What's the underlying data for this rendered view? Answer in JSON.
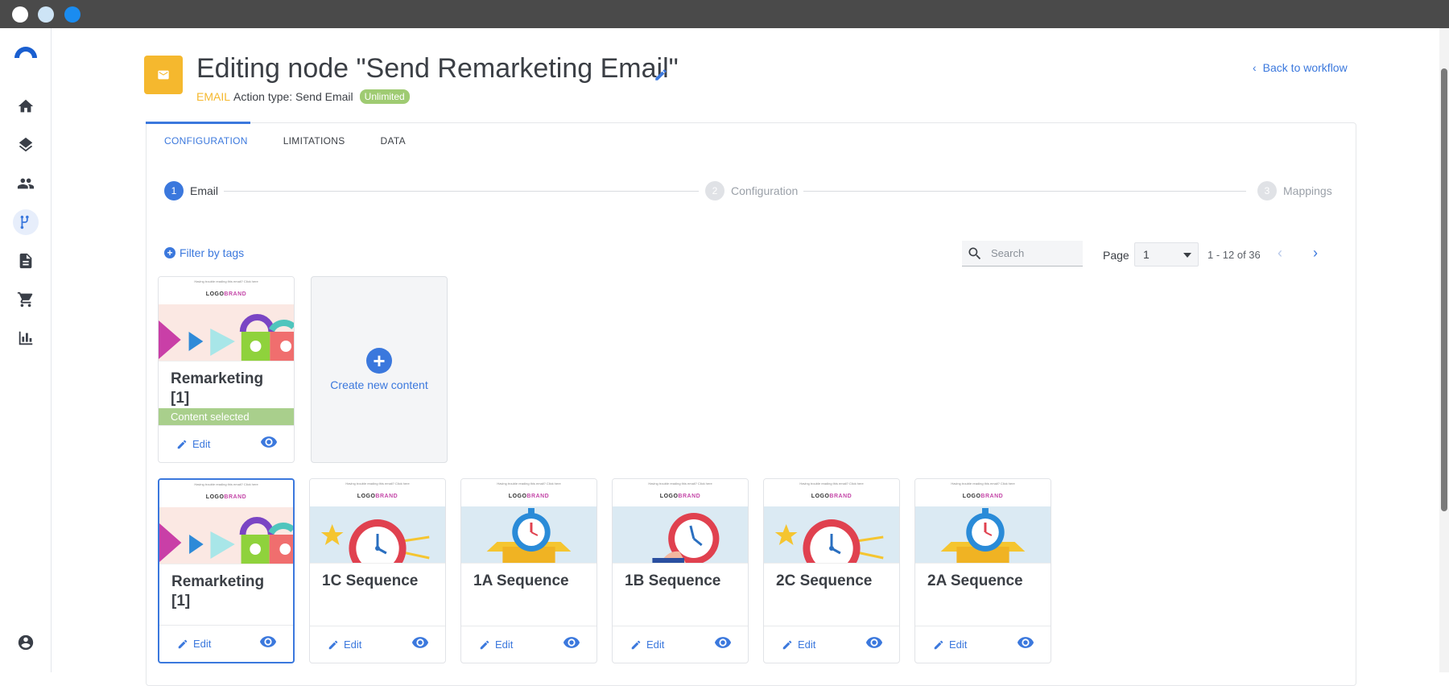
{
  "window": {
    "controls": [
      "close",
      "minimize",
      "maximize"
    ]
  },
  "sidebar": {
    "items": [
      {
        "name": "home",
        "icon": "home-icon",
        "active": false
      },
      {
        "name": "layers",
        "icon": "layers-icon",
        "active": false
      },
      {
        "name": "audience",
        "icon": "people-icon",
        "active": false
      },
      {
        "name": "workflows",
        "icon": "workflow-icon",
        "active": true
      },
      {
        "name": "content",
        "icon": "document-icon",
        "active": false
      },
      {
        "name": "commerce",
        "icon": "cart-icon",
        "active": false
      },
      {
        "name": "analytics",
        "icon": "chart-icon",
        "active": false
      }
    ],
    "account_icon": "account-circle-icon"
  },
  "header": {
    "title": "Editing node \"Send Remarketing Email\"",
    "node_type": "EMAIL",
    "action_type": "Action type: Send Email",
    "badge": "Unlimited",
    "back_link": "Back to workflow"
  },
  "tabs": [
    {
      "label": "CONFIGURATION",
      "active": true
    },
    {
      "label": "LIMITATIONS",
      "active": false
    },
    {
      "label": "DATA",
      "active": false
    }
  ],
  "stepper": [
    {
      "num": "1",
      "label": "Email",
      "state": "done"
    },
    {
      "num": "2",
      "label": "Configuration",
      "state": "todo"
    },
    {
      "num": "3",
      "label": "Mappings",
      "state": "todo"
    }
  ],
  "toolbar": {
    "filter_label": "Filter by tags",
    "search_placeholder": "Search",
    "page_label": "Page",
    "page_value": "1",
    "range": "1 - 12 of 36"
  },
  "selected_card": {
    "title": "Remarketing [1]",
    "selected_label": "Content selected",
    "edit_label": "Edit"
  },
  "create_card": {
    "label": "Create new content"
  },
  "cards": [
    {
      "title": "Remarketing [1]",
      "edit_label": "Edit",
      "thumb": "shapes",
      "selected": true
    },
    {
      "title": "1C Sequence",
      "edit_label": "Edit",
      "thumb": "clock",
      "selected": false
    },
    {
      "title": "1A Sequence",
      "edit_label": "Edit",
      "thumb": "box",
      "selected": false
    },
    {
      "title": "1B Sequence",
      "edit_label": "Edit",
      "thumb": "hand",
      "selected": false
    },
    {
      "title": "2C Sequence",
      "edit_label": "Edit",
      "thumb": "clock",
      "selected": false
    },
    {
      "title": "2A Sequence",
      "edit_label": "Edit",
      "thumb": "box",
      "selected": false
    }
  ],
  "thumb_text": {
    "logo_a": "LOGO",
    "logo_b": "BRAND",
    "preheader": "Having trouble reading this email? Click here"
  },
  "colors": {
    "accent": "#3b78dd",
    "email_icon": "#f5b82e",
    "badge": "#9fcb72",
    "selected_bar": "#a9cf8c"
  }
}
